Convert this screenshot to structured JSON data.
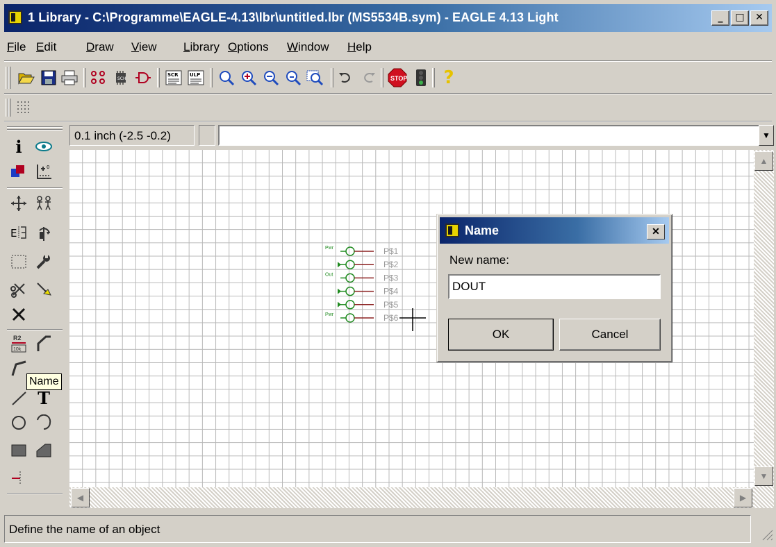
{
  "window": {
    "title": "1 Library - C:\\Programme\\EAGLE-4.13\\lbr\\untitled.lbr (MS5534B.sym) - EAGLE 4.13 Light"
  },
  "menu": [
    "File",
    "Edit",
    "Draw",
    "View",
    "Library",
    "Options",
    "Window",
    "Help"
  ],
  "coords": "0.1 inch (-2.5 -0.2)",
  "command_input": "",
  "tooltip": "Name",
  "status": "Define the name of an object",
  "schematic": {
    "pin_labels": [
      "P$1",
      "P$2",
      "P$3",
      "P$4",
      "P$5",
      "P$6"
    ],
    "pin_tags": [
      "Pwr",
      "",
      "Out",
      "",
      "",
      "Pwr"
    ]
  },
  "dialog": {
    "title": "Name",
    "label": "New name:",
    "value": "DOUT",
    "ok": "OK",
    "cancel": "Cancel"
  },
  "colors": {
    "title_start": "#0a246a",
    "title_end": "#a6caf0",
    "pin_green": "#1f8a1f",
    "pin_red": "#8b2020",
    "grid": "#b8b8b8"
  },
  "icons": {
    "toolbar": [
      "open-icon",
      "save-icon",
      "print-icon",
      "package-icon",
      "chip-icon",
      "symbol-icon",
      "script-icon",
      "ulp-icon",
      "zoom-fit-icon",
      "zoom-in-icon",
      "zoom-out-icon",
      "zoom-redraw-icon",
      "zoom-select-icon",
      "undo-icon",
      "redo-icon",
      "stop-icon",
      "go-icon",
      "help-icon"
    ],
    "tools": [
      "info-icon",
      "show-icon",
      "layer-icon",
      "mark-icon",
      "move-icon",
      "copy-icon",
      "mirror-icon",
      "rotate-icon",
      "group-icon",
      "change-icon",
      "cut-icon",
      "paste-icon",
      "delete-icon",
      "name-value-icon",
      "miter-icon",
      "split-icon",
      "wire-icon",
      "text-icon",
      "circle-icon",
      "arc-icon",
      "rect-icon",
      "polygon-icon",
      "pin-icon"
    ]
  }
}
